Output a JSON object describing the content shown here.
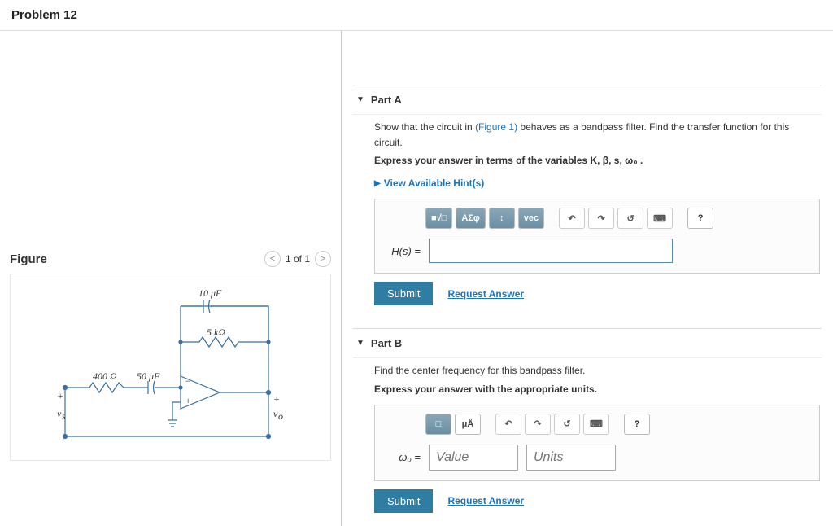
{
  "header": {
    "problem_title": "Problem 12"
  },
  "figure": {
    "title": "Figure",
    "nav": {
      "prev": "<",
      "count": "1 of 1",
      "next": ">"
    },
    "labels": {
      "c1": "10 μF",
      "r1": "5 kΩ",
      "r2": "400 Ω",
      "c2": "50 μF",
      "vs": "v_s",
      "vo": "v_o"
    }
  },
  "partA": {
    "title": "Part A",
    "instr_prefix": "Show that the circuit in ",
    "instr_link": "(Figure 1)",
    "instr_suffix": " behaves as a bandpass filter. Find the transfer function for this circuit.",
    "bold_line": "Express your answer in terms of the variables K, β, s, ω₀ .",
    "hints_label": "View Available Hint(s)",
    "lhs": "H(s) =",
    "toolbar": {
      "t1": "■√□",
      "t2": "ΑΣφ",
      "t3": "↕",
      "t4": "vec",
      "undo": "↶",
      "redo": "↷",
      "reset": "↺",
      "kb": "⌨",
      "help": "?"
    },
    "submit": "Submit",
    "request": "Request Answer"
  },
  "partB": {
    "title": "Part B",
    "instr": "Find the center frequency for this bandpass filter.",
    "bold_line": "Express your answer with the appropriate units.",
    "lhs": "ω₀ =",
    "value_ph": "Value",
    "units_ph": "Units",
    "toolbar": {
      "t1": "□",
      "t2": "μÅ",
      "undo": "↶",
      "redo": "↷",
      "reset": "↺",
      "kb": "⌨",
      "help": "?"
    },
    "submit": "Submit",
    "request": "Request Answer"
  }
}
